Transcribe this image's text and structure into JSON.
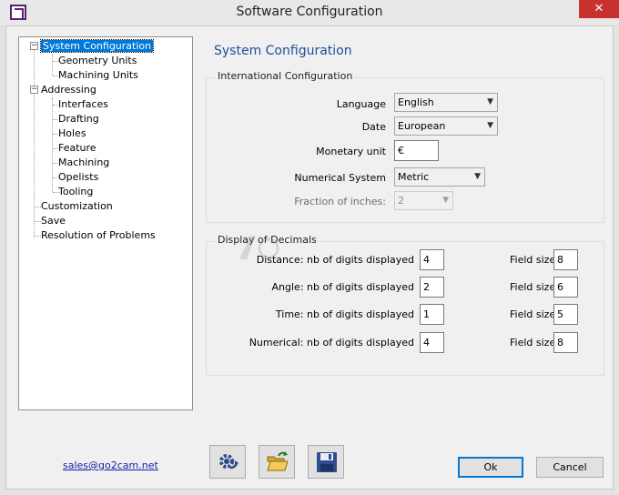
{
  "window": {
    "title": "Software Configuration",
    "close_glyph": "✕"
  },
  "tree": {
    "items": [
      {
        "label": "System Configuration",
        "selected": true
      },
      {
        "label": "Geometry Units"
      },
      {
        "label": "Machining Units"
      },
      {
        "label": "Addressing"
      },
      {
        "label": "Interfaces"
      },
      {
        "label": "Drafting"
      },
      {
        "label": "Holes"
      },
      {
        "label": "Feature"
      },
      {
        "label": "Machining"
      },
      {
        "label": "Opelists"
      },
      {
        "label": "Tooling"
      },
      {
        "label": "Customization"
      },
      {
        "label": "Save"
      },
      {
        "label": "Resolution of Problems"
      }
    ],
    "expand_glyph": "−"
  },
  "panel": {
    "title": "System Configuration",
    "intl": {
      "legend": "International Configuration",
      "language_label": "Language",
      "language_value": "English",
      "date_label": "Date",
      "date_value": "European",
      "monetary_label": "Monetary unit",
      "monetary_value": "€",
      "numsys_label": "Numerical System",
      "numsys_value": "Metric",
      "fraction_label": "Fraction of inches:",
      "fraction_value": "2"
    },
    "decimals": {
      "legend": "Display of Decimals",
      "field_size_label": "Field size",
      "rows": [
        {
          "label": "Distance: nb of digits displayed",
          "digits": "4",
          "field_size": "8"
        },
        {
          "label": "Angle: nb of digits displayed",
          "digits": "2",
          "field_size": "6"
        },
        {
          "label": "Time: nb of digits displayed",
          "digits": "1",
          "field_size": "5"
        },
        {
          "label": "Numerical: nb of digits displayed",
          "digits": "4",
          "field_size": "8"
        }
      ]
    }
  },
  "footer": {
    "email": "sales@go2cam.net",
    "tools": [
      "settings-icon",
      "open-folder-icon",
      "save-disk-icon"
    ],
    "ok_label": "Ok",
    "cancel_label": "Cancel"
  },
  "colors": {
    "accent": "#0078d7",
    "title_blue": "#1f4e99",
    "close_red": "#c7312e"
  }
}
